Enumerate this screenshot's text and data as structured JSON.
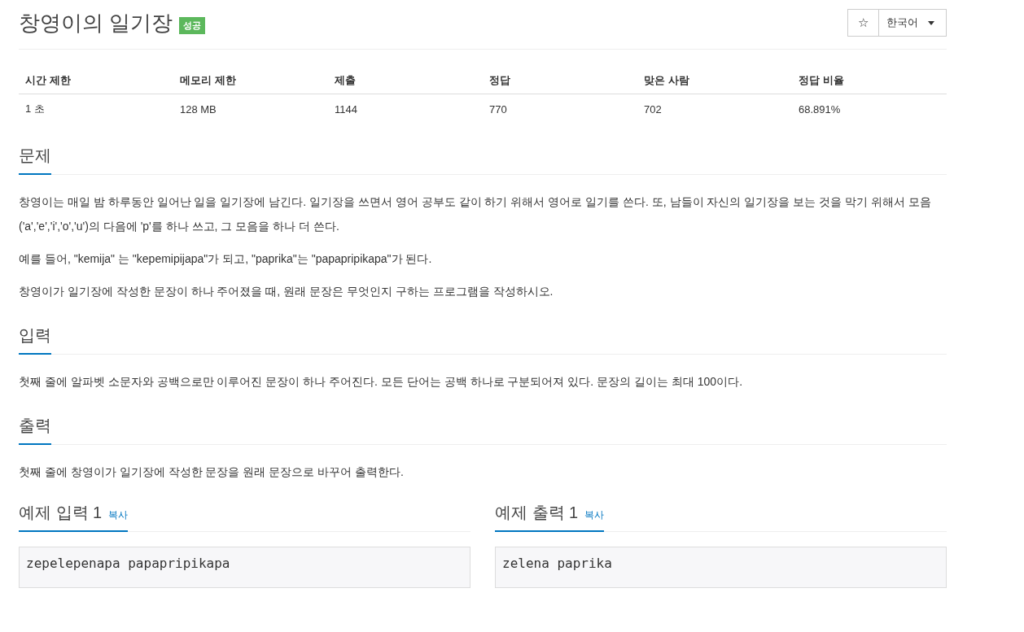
{
  "title": "창영이의 일기장",
  "result_badge": {
    "label": "성공",
    "kind": "success"
  },
  "toolbar": {
    "star": "☆",
    "language": "한국어"
  },
  "stats": {
    "columns": [
      "시간 제한",
      "메모리 제한",
      "제출",
      "정답",
      "맞은 사람",
      "정답 비율"
    ],
    "rows": [
      [
        "1 초",
        "128 MB",
        "1144",
        "770",
        "702",
        "68.891%"
      ]
    ]
  },
  "sections": [
    {
      "title": "문제",
      "paragraphs": [
        "창영이는 매일 밤 하루동안 일어난 일을 일기장에 남긴다. 일기장을 쓰면서 영어 공부도 같이 하기 위해서 영어로 일기를 쓴다. 또, 남들이 자신의 일기장을 보는 것을 막기 위해서 모음('a','e','i','o','u')의 다음에 'p'를 하나 쓰고, 그 모음을 하나 더 쓴다.",
        "예를 들어, \"kemija\" 는 \"kepemipijapa\"가 되고, \"paprika\"는 \"papapripikapa\"가 된다.",
        "창영이가 일기장에 작성한 문장이 하나 주어졌을 때, 원래 문장은 무엇인지 구하는 프로그램을 작성하시오."
      ]
    },
    {
      "title": "입력",
      "paragraphs": [
        "첫째 줄에 알파벳 소문자와 공백으로만 이루어진 문장이 하나 주어진다. 모든 단어는 공백 하나로 구분되어져 있다. 문장의 길이는 최대 100이다."
      ]
    },
    {
      "title": "출력",
      "paragraphs": [
        "첫째 줄에 창영이가 일기장에 작성한 문장을 원래 문장으로 바꾸어 출력한다."
      ]
    }
  ],
  "samples": [
    {
      "title": "예제 입력 1",
      "copy": "복사",
      "content": "zepelepenapa papapripikapa"
    },
    {
      "title": "예제 출력 1",
      "copy": "복사",
      "content": "zelena paprika"
    }
  ]
}
